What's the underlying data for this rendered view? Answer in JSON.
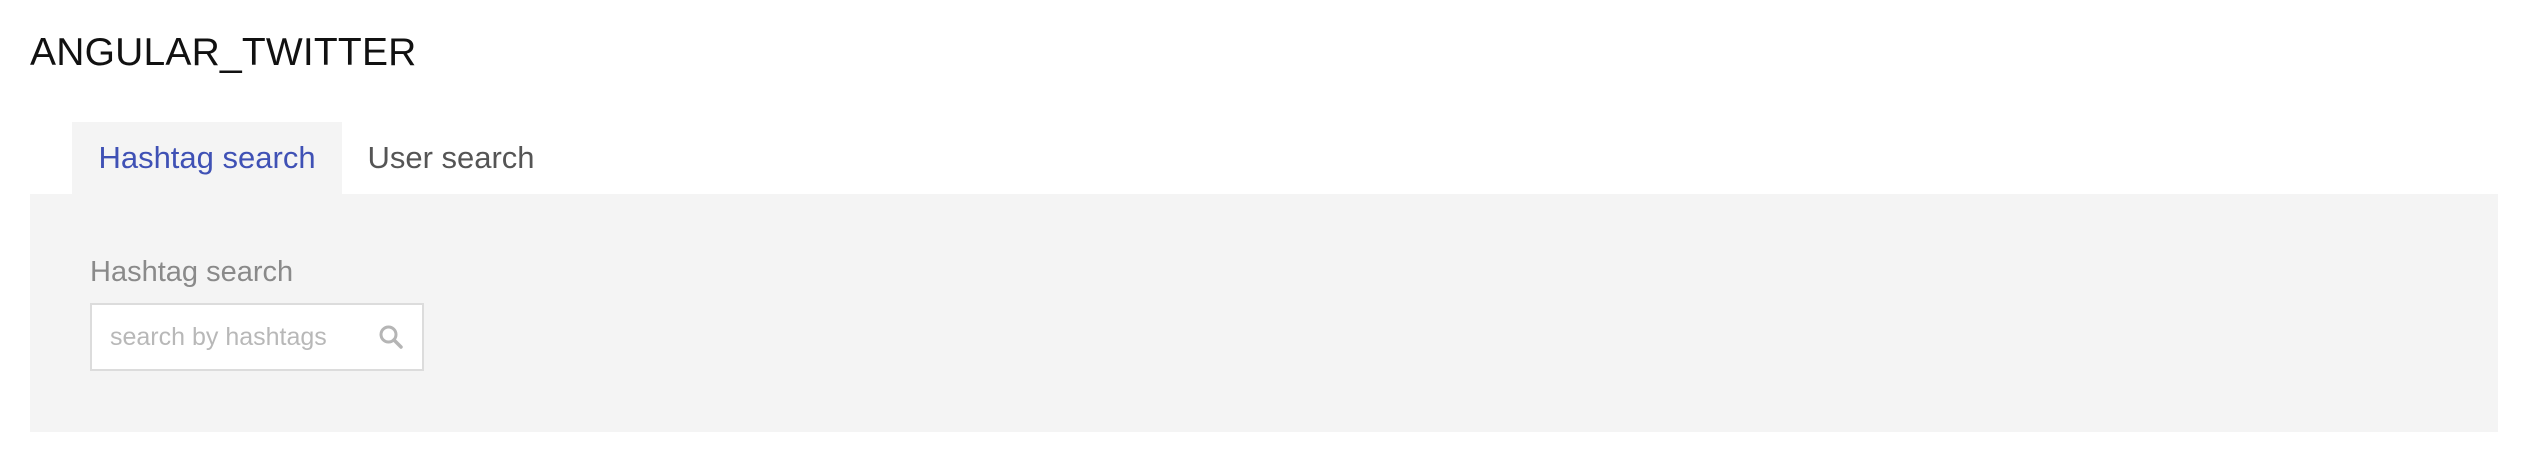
{
  "app": {
    "title": "ANGULAR_TWITTER"
  },
  "tabs": [
    {
      "label": "Hashtag search",
      "active": true
    },
    {
      "label": "User search",
      "active": false
    }
  ],
  "hashtag_panel": {
    "field_label": "Hashtag search",
    "search": {
      "value": "",
      "placeholder": "search by hashtags",
      "icon": "search-icon"
    }
  },
  "colors": {
    "accent": "#3f51b5",
    "panel_bg": "#f4f4f4",
    "label_gray": "#8a8a8a",
    "input_border": "#dcdcdc"
  }
}
